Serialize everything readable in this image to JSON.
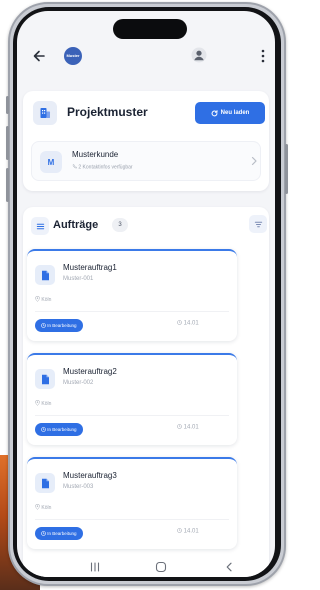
{
  "logo": {
    "text": "Muster"
  },
  "project": {
    "title": "Projektmuster",
    "reload_label": "Neu laden",
    "customer": {
      "initial": "M",
      "name": "Musterkunde",
      "contacts": "2 Kontaktinfos verfügbar"
    }
  },
  "orders": {
    "title": "Aufträge",
    "count": "3",
    "items": [
      {
        "title": "Musterauftrag1",
        "id": "Muster-001",
        "city": "Köln",
        "status": "In Bearbeitung",
        "date": "14.01"
      },
      {
        "title": "Musterauftrag2",
        "id": "Muster-002",
        "city": "Köln",
        "status": "In Bearbeitung",
        "date": "14.01"
      },
      {
        "title": "Musterauftrag3",
        "id": "Muster-003",
        "city": "Köln",
        "status": "In Bearbeitung",
        "date": "14.01"
      }
    ]
  },
  "colors": {
    "accent": "#2f6fe4",
    "card_top_border": "#3b7ae8",
    "screen_background": "#f4f5f8",
    "text_primary": "#1b2333",
    "text_muted": "#a2a8b3"
  },
  "icons": {
    "back": "arrow-left-icon",
    "user": "user-icon",
    "more": "more-vertical-icon",
    "project": "building-icon",
    "reload": "refresh-icon",
    "chevron": "chevron-right-icon",
    "orders": "list-icon",
    "filter": "filter-icon",
    "order": "document-icon",
    "location": "pin-icon",
    "date": "clock-icon"
  }
}
